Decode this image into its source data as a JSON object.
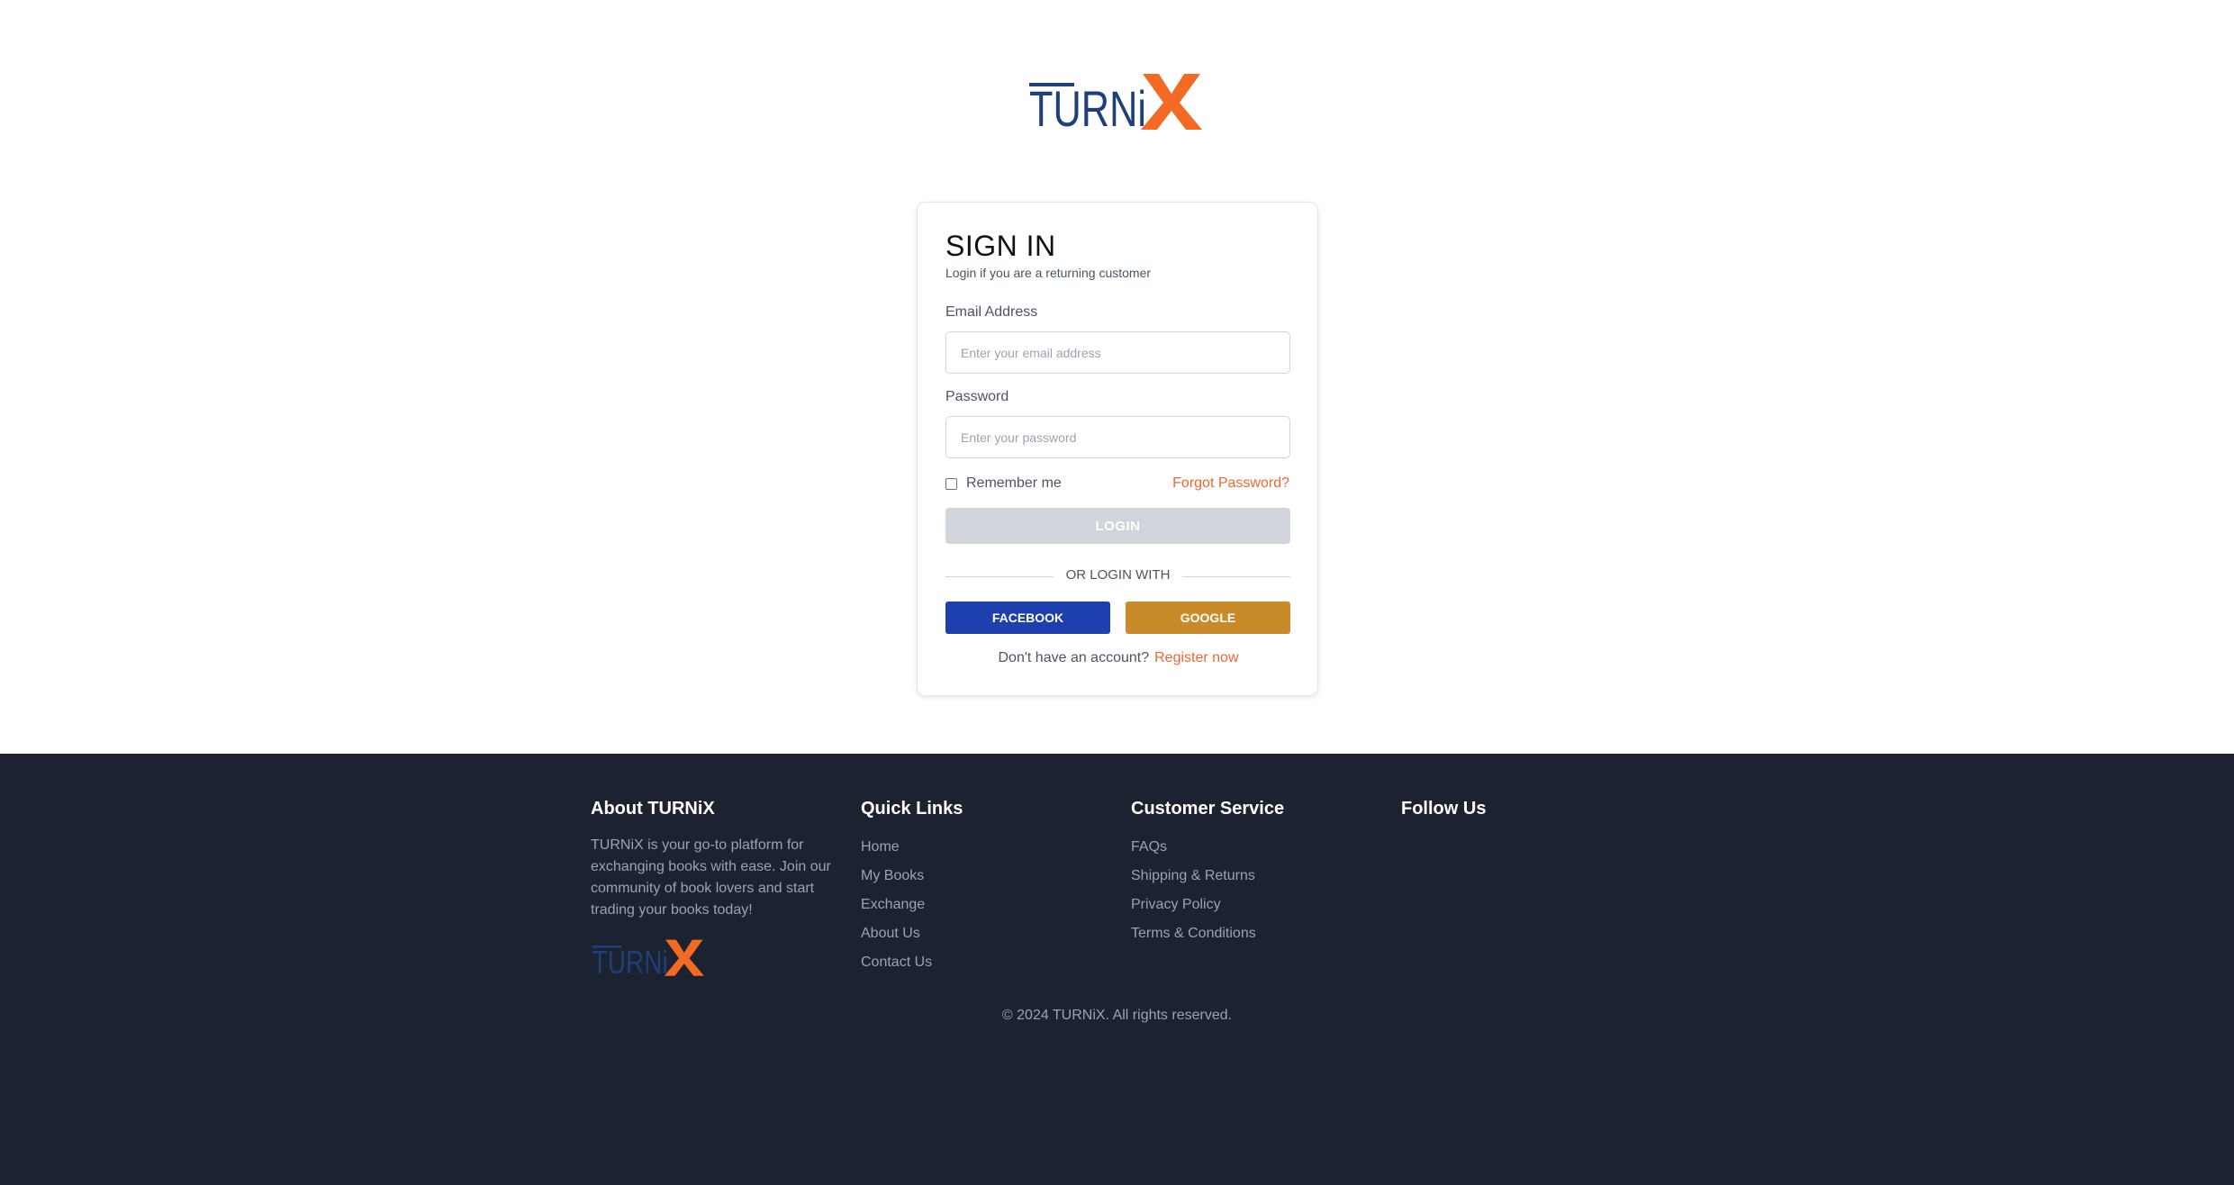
{
  "brand": {
    "logo_text_main": "TURNi",
    "logo_text_x": "X",
    "colors": {
      "navy": "#1e3f7a",
      "orange": "#f26a24",
      "link_orange": "#f0662e"
    }
  },
  "signin": {
    "title": "SIGN IN",
    "subtitle": "Login if you are a returning customer",
    "email_label": "Email Address",
    "email_placeholder": "Enter your email address",
    "password_label": "Password",
    "password_placeholder": "Enter your password",
    "remember_label": "Remember me",
    "forgot_label": "Forgot Password?",
    "login_label": "LOGIN",
    "divider_text": "OR LOGIN WITH",
    "facebook_label": "FACEBOOK",
    "google_label": "GOOGLE",
    "register_prompt": "Don't have an account?",
    "register_link": "Register now"
  },
  "footer": {
    "about": {
      "heading": "About TURNiX",
      "text": "TURNiX is your go-to platform for exchanging books with ease. Join our community of book lovers and start trading your books today!"
    },
    "quick_links": {
      "heading": "Quick Links",
      "items": [
        "Home",
        "My Books",
        "Exchange",
        "About Us",
        "Contact Us"
      ]
    },
    "customer_service": {
      "heading": "Customer Service",
      "items": [
        "FAQs",
        "Shipping & Returns",
        "Privacy Policy",
        "Terms & Conditions"
      ]
    },
    "follow": {
      "heading": "Follow Us"
    },
    "copyright": "© 2024 TURNiX. All rights reserved."
  }
}
